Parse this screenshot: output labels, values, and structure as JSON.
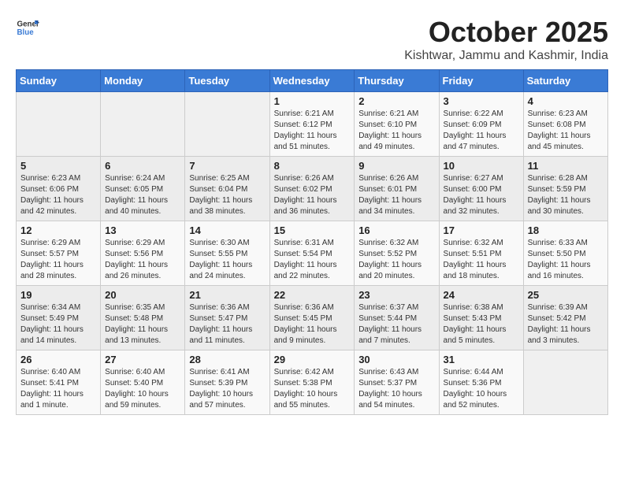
{
  "header": {
    "logo_general": "General",
    "logo_blue": "Blue",
    "month": "October 2025",
    "location": "Kishtwar, Jammu and Kashmir, India"
  },
  "weekdays": [
    "Sunday",
    "Monday",
    "Tuesday",
    "Wednesday",
    "Thursday",
    "Friday",
    "Saturday"
  ],
  "weeks": [
    [
      {
        "day": "",
        "info": ""
      },
      {
        "day": "",
        "info": ""
      },
      {
        "day": "",
        "info": ""
      },
      {
        "day": "1",
        "info": "Sunrise: 6:21 AM\nSunset: 6:12 PM\nDaylight: 11 hours\nand 51 minutes."
      },
      {
        "day": "2",
        "info": "Sunrise: 6:21 AM\nSunset: 6:10 PM\nDaylight: 11 hours\nand 49 minutes."
      },
      {
        "day": "3",
        "info": "Sunrise: 6:22 AM\nSunset: 6:09 PM\nDaylight: 11 hours\nand 47 minutes."
      },
      {
        "day": "4",
        "info": "Sunrise: 6:23 AM\nSunset: 6:08 PM\nDaylight: 11 hours\nand 45 minutes."
      }
    ],
    [
      {
        "day": "5",
        "info": "Sunrise: 6:23 AM\nSunset: 6:06 PM\nDaylight: 11 hours\nand 42 minutes."
      },
      {
        "day": "6",
        "info": "Sunrise: 6:24 AM\nSunset: 6:05 PM\nDaylight: 11 hours\nand 40 minutes."
      },
      {
        "day": "7",
        "info": "Sunrise: 6:25 AM\nSunset: 6:04 PM\nDaylight: 11 hours\nand 38 minutes."
      },
      {
        "day": "8",
        "info": "Sunrise: 6:26 AM\nSunset: 6:02 PM\nDaylight: 11 hours\nand 36 minutes."
      },
      {
        "day": "9",
        "info": "Sunrise: 6:26 AM\nSunset: 6:01 PM\nDaylight: 11 hours\nand 34 minutes."
      },
      {
        "day": "10",
        "info": "Sunrise: 6:27 AM\nSunset: 6:00 PM\nDaylight: 11 hours\nand 32 minutes."
      },
      {
        "day": "11",
        "info": "Sunrise: 6:28 AM\nSunset: 5:59 PM\nDaylight: 11 hours\nand 30 minutes."
      }
    ],
    [
      {
        "day": "12",
        "info": "Sunrise: 6:29 AM\nSunset: 5:57 PM\nDaylight: 11 hours\nand 28 minutes."
      },
      {
        "day": "13",
        "info": "Sunrise: 6:29 AM\nSunset: 5:56 PM\nDaylight: 11 hours\nand 26 minutes."
      },
      {
        "day": "14",
        "info": "Sunrise: 6:30 AM\nSunset: 5:55 PM\nDaylight: 11 hours\nand 24 minutes."
      },
      {
        "day": "15",
        "info": "Sunrise: 6:31 AM\nSunset: 5:54 PM\nDaylight: 11 hours\nand 22 minutes."
      },
      {
        "day": "16",
        "info": "Sunrise: 6:32 AM\nSunset: 5:52 PM\nDaylight: 11 hours\nand 20 minutes."
      },
      {
        "day": "17",
        "info": "Sunrise: 6:32 AM\nSunset: 5:51 PM\nDaylight: 11 hours\nand 18 minutes."
      },
      {
        "day": "18",
        "info": "Sunrise: 6:33 AM\nSunset: 5:50 PM\nDaylight: 11 hours\nand 16 minutes."
      }
    ],
    [
      {
        "day": "19",
        "info": "Sunrise: 6:34 AM\nSunset: 5:49 PM\nDaylight: 11 hours\nand 14 minutes."
      },
      {
        "day": "20",
        "info": "Sunrise: 6:35 AM\nSunset: 5:48 PM\nDaylight: 11 hours\nand 13 minutes."
      },
      {
        "day": "21",
        "info": "Sunrise: 6:36 AM\nSunset: 5:47 PM\nDaylight: 11 hours\nand 11 minutes."
      },
      {
        "day": "22",
        "info": "Sunrise: 6:36 AM\nSunset: 5:45 PM\nDaylight: 11 hours\nand 9 minutes."
      },
      {
        "day": "23",
        "info": "Sunrise: 6:37 AM\nSunset: 5:44 PM\nDaylight: 11 hours\nand 7 minutes."
      },
      {
        "day": "24",
        "info": "Sunrise: 6:38 AM\nSunset: 5:43 PM\nDaylight: 11 hours\nand 5 minutes."
      },
      {
        "day": "25",
        "info": "Sunrise: 6:39 AM\nSunset: 5:42 PM\nDaylight: 11 hours\nand 3 minutes."
      }
    ],
    [
      {
        "day": "26",
        "info": "Sunrise: 6:40 AM\nSunset: 5:41 PM\nDaylight: 11 hours\nand 1 minute."
      },
      {
        "day": "27",
        "info": "Sunrise: 6:40 AM\nSunset: 5:40 PM\nDaylight: 10 hours\nand 59 minutes."
      },
      {
        "day": "28",
        "info": "Sunrise: 6:41 AM\nSunset: 5:39 PM\nDaylight: 10 hours\nand 57 minutes."
      },
      {
        "day": "29",
        "info": "Sunrise: 6:42 AM\nSunset: 5:38 PM\nDaylight: 10 hours\nand 55 minutes."
      },
      {
        "day": "30",
        "info": "Sunrise: 6:43 AM\nSunset: 5:37 PM\nDaylight: 10 hours\nand 54 minutes."
      },
      {
        "day": "31",
        "info": "Sunrise: 6:44 AM\nSunset: 5:36 PM\nDaylight: 10 hours\nand 52 minutes."
      },
      {
        "day": "",
        "info": ""
      }
    ]
  ]
}
